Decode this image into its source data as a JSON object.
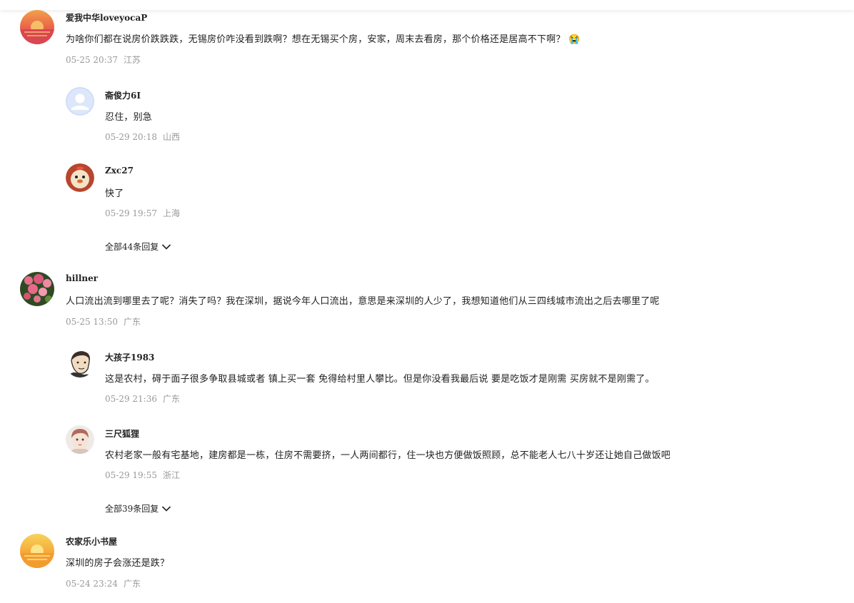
{
  "comments": [
    {
      "user": "爱我中华loveyocaP",
      "text": "为啥你们都在说房价跌跌跌，无锡房价咋没看到跌啊？想在无锡买个房，安家，周末去看房，那个价格还是居高不下啊？",
      "emoji": "😭",
      "time": "05-25 20:37",
      "location": "江苏",
      "avatar_icon": "sunset-avatar",
      "replies": [
        {
          "user": "斋俊力6I",
          "text": "忍住，别急",
          "time": "05-29 20:18",
          "location": "山西",
          "avatar_icon": "default-user-avatar"
        },
        {
          "user": "Zxc27",
          "text": "快了",
          "time": "05-29 19:57",
          "location": "上海",
          "avatar_icon": "cartoon-chick-avatar"
        }
      ],
      "more_replies": "全部44条回复"
    },
    {
      "user": "hillner",
      "text": "人口流出流到哪里去了呢？消失了吗？我在深圳，据说今年人口流出，意思是来深圳的人少了，我想知道他们从三四线城市流出之后去哪里了呢",
      "time": "05-25 13:50",
      "location": "广东",
      "avatar_icon": "flower-avatar",
      "replies": [
        {
          "user": "大孩子1983",
          "text": "这是农村，碍于面子很多争取县城或者 镇上买一套 免得给村里人攀比。但是你没看我最后说 要是吃饭才是刚需 买房就不是刚需了。",
          "time": "05-29 21:36",
          "location": "广东",
          "avatar_icon": "sketch-man-avatar"
        },
        {
          "user": "三尺狐狸",
          "text": "农村老家一般有宅基地，建房都是一栋，住房不需要挤，一人两间都行，住一块也方便做饭照顾，总不能老人七八十岁还让她自己做饭吧",
          "time": "05-29 19:55",
          "location": "浙江",
          "avatar_icon": "anime-boy-avatar"
        }
      ],
      "more_replies": "全部39条回复"
    },
    {
      "user": "农家乐小书屋",
      "text": "深圳的房子会涨还是跌？",
      "time": "05-24 23:24",
      "location": "广东",
      "avatar_icon": "sunset-avatar",
      "replies": []
    }
  ]
}
